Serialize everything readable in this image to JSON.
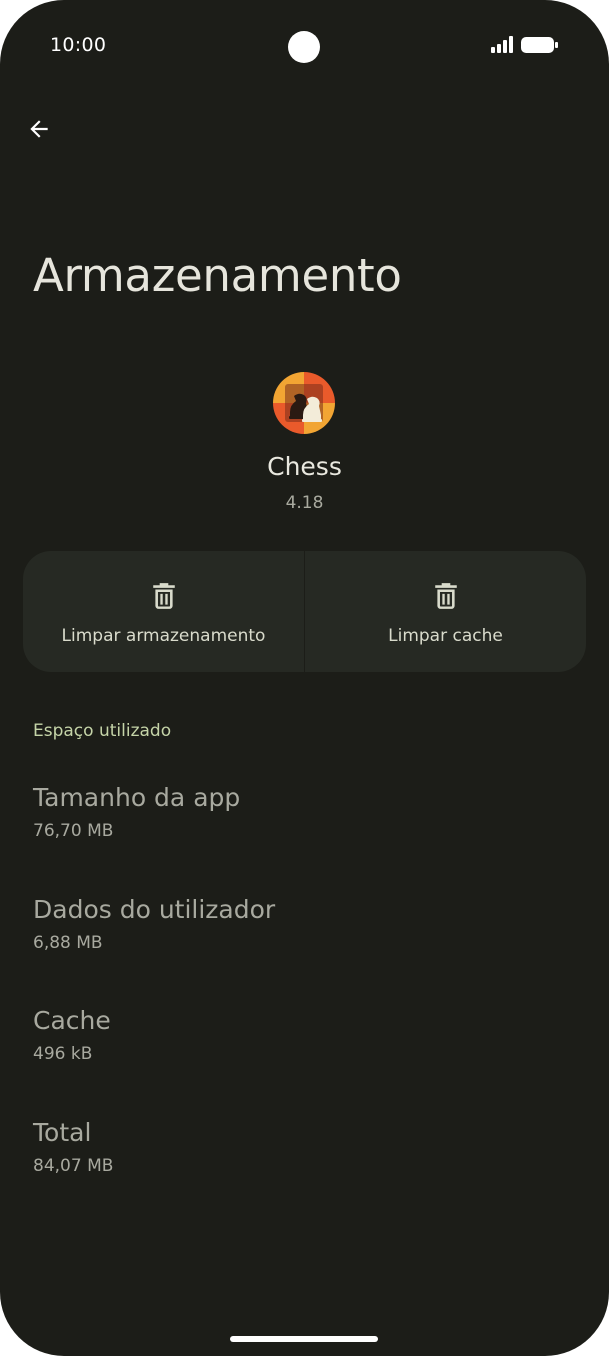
{
  "status_bar": {
    "time": "10:00"
  },
  "header": {
    "back_icon": "arrow-back-icon",
    "title": "Armazenamento"
  },
  "app": {
    "icon": "chess-app-icon",
    "name": "Chess",
    "version": "4.18"
  },
  "actions": {
    "clear_storage_label": "Limpar armazenamento",
    "clear_cache_label": "Limpar cache",
    "icon": "trash-icon"
  },
  "space_used": {
    "header": "Espaço utilizado",
    "items": [
      {
        "title": "Tamanho da app",
        "value": "76,70 MB"
      },
      {
        "title": "Dados do utilizador",
        "value": "6,88 MB"
      },
      {
        "title": "Cache",
        "value": "496 kB"
      },
      {
        "title": "Total",
        "value": "84,07 MB"
      }
    ]
  },
  "colors": {
    "background": "#1c1d18",
    "card": "#262923",
    "accent": "#c5d4a8"
  }
}
